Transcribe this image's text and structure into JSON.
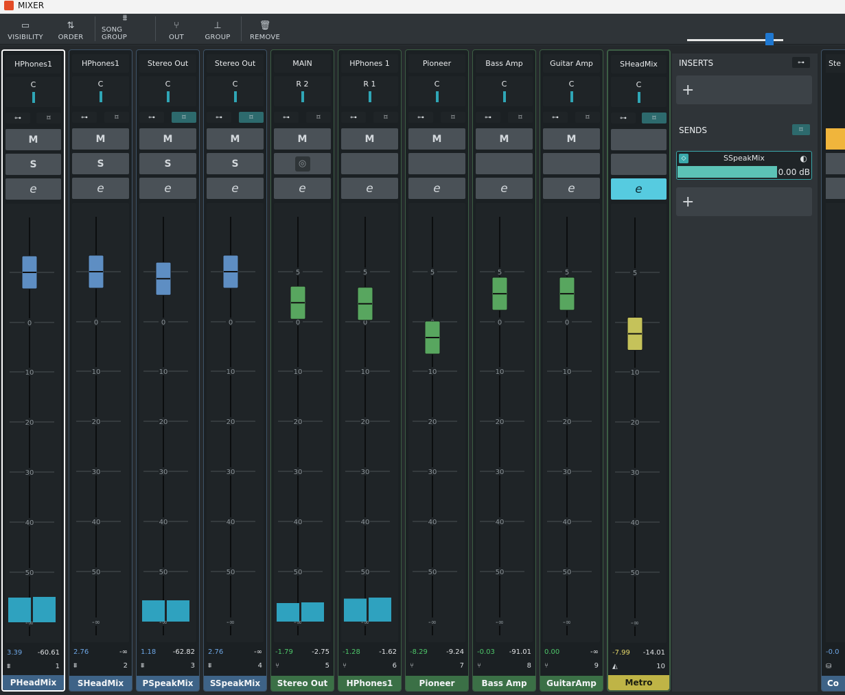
{
  "app": {
    "title": "MIXER"
  },
  "toolbar": {
    "items": [
      {
        "label": "VISIBILITY",
        "icon": "visibility-icon"
      },
      {
        "label": "ORDER",
        "icon": "order-icon"
      },
      {
        "label": "SONG GROUP",
        "icon": "song-group-icon"
      },
      {
        "label": "OUT",
        "icon": "out-icon"
      },
      {
        "label": "GROUP",
        "icon": "group-icon"
      },
      {
        "label": "REMOVE",
        "icon": "trash-icon"
      }
    ]
  },
  "fader_scale": [
    "5",
    "0",
    "10",
    "20",
    "30",
    "40",
    "50",
    "-∞"
  ],
  "buttons": {
    "mute": "M",
    "solo": "S",
    "edit": "e"
  },
  "channels": [
    {
      "output": "HPhones1",
      "pan": "C",
      "label": "PHeadMix",
      "number": "1",
      "type_icon": "song-group-icon",
      "level": "3.39",
      "peak": "-60.61",
      "fader": 0.265,
      "meter": [
        0.72,
        0.74
      ],
      "style": "blue",
      "selected": true,
      "link_active": false,
      "solo": true,
      "monitor": false,
      "edit_active": false
    },
    {
      "output": "HPhones1",
      "pan": "C",
      "label": "SHeadMix",
      "number": "2",
      "type_icon": "song-group-icon",
      "level": "2.76",
      "peak": "-∞",
      "fader": 0.25,
      "meter": [
        0,
        0
      ],
      "style": "blue",
      "selected": false,
      "link_active": false,
      "solo": true,
      "monitor": false,
      "edit_active": false
    },
    {
      "output": "Stereo Out",
      "pan": "C",
      "label": "PSpeakMix",
      "number": "3",
      "type_icon": "song-group-icon",
      "level": "1.18",
      "peak": "-62.82",
      "fader": 0.215,
      "meter": [
        0.62,
        0.62
      ],
      "style": "blue",
      "selected": false,
      "link_active": true,
      "solo": true,
      "monitor": false,
      "edit_active": false
    },
    {
      "output": "Stereo Out",
      "pan": "C",
      "label": "SSpeakMix",
      "number": "4",
      "type_icon": "song-group-icon",
      "level": "2.76",
      "peak": "-∞",
      "fader": 0.25,
      "meter": [
        0,
        0
      ],
      "style": "blue",
      "selected": false,
      "link_active": true,
      "solo": true,
      "monitor": false,
      "edit_active": false
    },
    {
      "output": "MAIN",
      "pan": "R 2",
      "label": "Stereo Out",
      "number": "5",
      "type_icon": "out-icon",
      "level": "-1.79",
      "peak": "-2.75",
      "fader": 0.095,
      "meter": [
        0.54,
        0.56
      ],
      "style": "green",
      "selected": false,
      "link_active": false,
      "solo": false,
      "monitor": true,
      "edit_active": false
    },
    {
      "output": "HPhones 1",
      "pan": "R 1",
      "label": "HPhones1",
      "number": "6",
      "type_icon": "out-icon",
      "level": "-1.28",
      "peak": "-1.62",
      "fader": 0.09,
      "meter": [
        0.67,
        0.7
      ],
      "style": "green",
      "selected": false,
      "link_active": false,
      "solo": false,
      "monitor": false,
      "edit_active": false
    },
    {
      "output": "Pioneer",
      "pan": "C",
      "label": "Pioneer",
      "number": "7",
      "type_icon": "out-icon",
      "level": "-8.29",
      "peak": "-9.24",
      "fader": -0.16,
      "meter": [
        0,
        0
      ],
      "style": "green",
      "selected": false,
      "link_active": false,
      "solo": false,
      "monitor": false,
      "edit_active": false
    },
    {
      "output": "Bass Amp",
      "pan": "C",
      "label": "Bass Amp",
      "number": "8",
      "type_icon": "out-icon",
      "level": "-0.03",
      "peak": "-91.01",
      "fader": 0.14,
      "meter": [
        0,
        0
      ],
      "style": "green",
      "selected": false,
      "link_active": false,
      "solo": false,
      "monitor": false,
      "edit_active": false
    },
    {
      "output": "Guitar Amp",
      "pan": "C",
      "label": "GuitarAmp",
      "number": "9",
      "type_icon": "out-icon",
      "level": "0.00",
      "peak": "-∞",
      "fader": 0.14,
      "meter": [
        0,
        0
      ],
      "style": "green",
      "selected": false,
      "link_active": false,
      "solo": false,
      "monitor": false,
      "edit_active": false
    },
    {
      "output": "SHeadMix",
      "pan": "C",
      "label": "Metro",
      "number": "10",
      "type_icon": "metronome-icon",
      "level": "-7.99",
      "peak": "-14.01",
      "fader": -0.115,
      "meter": [
        0,
        0
      ],
      "style": "yellow",
      "selected": true,
      "link_active": true,
      "solo": false,
      "monitor": false,
      "edit_active": true
    }
  ],
  "panel": {
    "inserts_title": "INSERTS",
    "sends_title": "SENDS",
    "send": {
      "name": "SSpeakMix",
      "level": "0.00 dB",
      "fill": 0.74
    },
    "add": "+"
  },
  "edge_channel": {
    "output": "Ste",
    "level": "-0.0",
    "label": "Co"
  },
  "colors": {
    "blue_fader": "#5e8ec3",
    "green_fader": "#58a65f",
    "yellow_fader": "#c5c25a",
    "meter": "#2fa2bf",
    "level_blue": "#6ea7e6",
    "level_green": "#4ec76a",
    "level_yellow": "#e5d86a"
  }
}
